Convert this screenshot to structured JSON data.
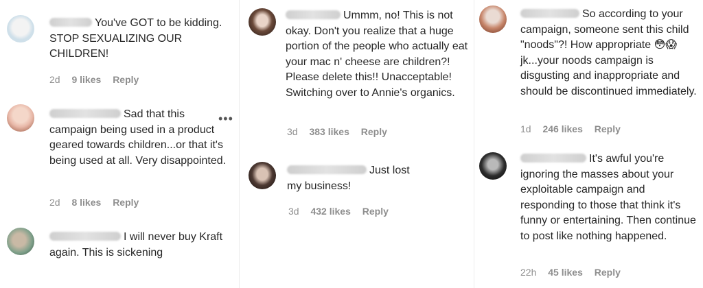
{
  "col1": [
    {
      "text": "You've GOT to be kidding. STOP SEXUALIZING OUR CHILDREN!",
      "time": "2d",
      "likes": "9 likes",
      "reply": "Reply",
      "avatar_colors": [
        "#cfe0ea",
        "#f3f3f3"
      ]
    },
    {
      "text": "Sad that this campaign being used in a product geared towards children...or that it's being used at all. Very disappointed.",
      "time": "2d",
      "likes": "8 likes",
      "reply": "Reply",
      "more": "•••",
      "avatar_colors": [
        "#e8b8a8",
        "#f4d7c9"
      ]
    },
    {
      "text": "I will never buy Kraft again. This is sickening",
      "avatar_colors": [
        "#7fa08a",
        "#c9b9a5"
      ]
    }
  ],
  "col2": [
    {
      "text": "Ummm, no! This is not okay. Don't you realize that a huge portion of the people who actually eat your mac n' cheese are children?! Please delete this!! Unacceptable! Switching over to Annie's organics.",
      "time": "3d",
      "likes": "383 likes",
      "reply": "Reply",
      "avatar_colors": [
        "#6b4a3a",
        "#e9d4c8"
      ]
    },
    {
      "text": "Just lost my business!",
      "time": "3d",
      "likes": "432 likes",
      "reply": "Reply",
      "avatar_colors": [
        "#4e3a33",
        "#d9c2b4"
      ]
    }
  ],
  "col3": [
    {
      "text": "So according to your campaign, someone sent this child \"noods\"?! How appropriate 😳😱 jk...your noods campaign is disgusting and inappropriate and should be discontinued immediately.",
      "time": "1d",
      "likes": "246 likes",
      "reply": "Reply",
      "avatar_colors": [
        "#c7866b",
        "#eadbd3"
      ]
    },
    {
      "text": "It's awful you're ignoring the masses about your exploitable campaign and responding to those that think it's funny or entertaining. Then continue to post like nothing happened.",
      "time": "22h",
      "likes": "45 likes",
      "reply": "Reply",
      "avatar_colors": [
        "#2d2d2d",
        "#b9b9b9"
      ]
    }
  ]
}
